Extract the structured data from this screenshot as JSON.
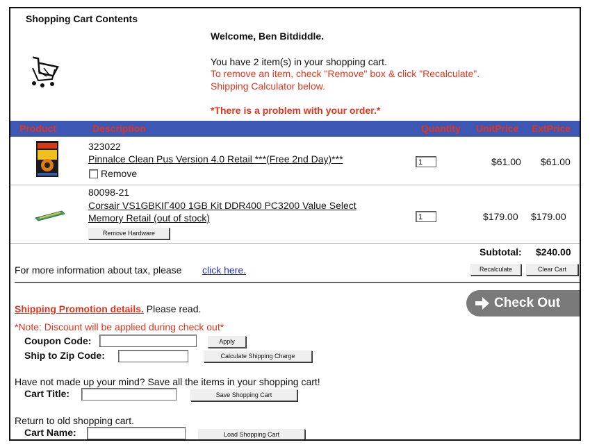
{
  "cart": {
    "heading": "Shopping Cart Contents",
    "welcome": "Welcome, Ben Bitdiddle.",
    "item_count_text": "You have 2 item(s) in your shopping cart.",
    "remove_hint": "To remove an item, check \"Remove\" box & click \"Recalculate\".",
    "shipping_hint": "Shipping Calculator below.",
    "problem": "*There is a problem with your order.*"
  },
  "columns": {
    "product": "Product",
    "description": "Description",
    "quantity": "Quantity",
    "unit_price": "UnitPrice",
    "ext_price": "ExtPrice"
  },
  "items": [
    {
      "sku": "323022",
      "name": "Pinnalce Clean Pus Version 4.0 Retail ***(Free 2nd Day)***",
      "quantity": "1",
      "unit_price": "$61.00",
      "ext_price": "$61.00",
      "remove_label": "Remove"
    },
    {
      "sku": "80098-21",
      "name_line1": "Corsair VS1GBKIΓ400 1GB Kit DDR400 PC3200 Value Select",
      "name_line2": "Memory Retail (out of stock)",
      "quantity": "1",
      "unit_price": "$179.00",
      "ext_price": "$179.00",
      "remove_button": "Remove Hardware"
    }
  ],
  "totals": {
    "subtotal_label": "Subtotal:",
    "subtotal_value": "$240.00",
    "recalculate": "Recalculate",
    "clear_cart": "Clear Cart"
  },
  "tax": {
    "text": "For more information about tax, please",
    "link": "click here."
  },
  "shipping": {
    "promo_link": "Shipping Promotion details.",
    "promo_text": "Please read.",
    "note": "*Note: Discount will be applied during check out*",
    "checkout": "Check Out",
    "coupon_label": "Coupon Code:",
    "apply": "Apply",
    "zip_label": "Ship to Zip Code:",
    "calc_shipping": "Calculate Shipping Charge"
  },
  "save_cart": {
    "prompt": "Have not made up your mind? Save all the items in your shopping cart!",
    "title_label": "Cart Title:",
    "save_button": "Save Shopping Cart"
  },
  "load_cart": {
    "prompt": "Return to old shopping cart.",
    "name_label": "Cart Name:",
    "load_button": "Load Shopping Cart"
  },
  "icons": {
    "cart": "shopping-cart-icon",
    "checkout_arrow": "arrow-right-icon"
  },
  "colors": {
    "header_bg": "#3d57b4",
    "header_text": "#e2341c",
    "alert_red": "#e2341c",
    "link_blue": "#2431c6",
    "checkout_bg": "#7a7a7a"
  }
}
